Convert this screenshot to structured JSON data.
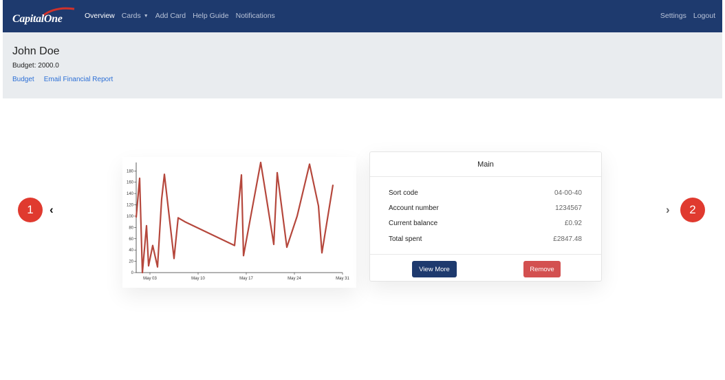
{
  "nav": {
    "logo_text": "CapitalOne",
    "items": [
      {
        "label": "Overview",
        "active": true
      },
      {
        "label": "Cards",
        "dropdown": true
      },
      {
        "label": "Add Card"
      },
      {
        "label": "Help Guide"
      },
      {
        "label": "Notifications"
      }
    ],
    "right_items": [
      {
        "label": "Settings"
      },
      {
        "label": "Logout"
      }
    ]
  },
  "header": {
    "name": "John Doe",
    "budget": "Budget: 2000.0",
    "links": [
      "Budget",
      "Email Financial Report"
    ]
  },
  "carousel": {
    "badge_left": "1",
    "badge_right": "2",
    "prev_icon": "chevron-left-icon",
    "next_icon": "chevron-right-icon"
  },
  "account": {
    "title": "Main",
    "details": [
      {
        "label": "Sort code",
        "value": "04-00-40"
      },
      {
        "label": "Account number",
        "value": "1234567"
      },
      {
        "label": "Current balance",
        "value": "£0.92"
      },
      {
        "label": "Total spent",
        "value": "£2847.48"
      }
    ],
    "view_more_label": "View More",
    "remove_label": "Remove"
  },
  "colors": {
    "navbar": "#1e3a6e",
    "header_bg": "#e9ecef",
    "link": "#2c6fd6",
    "badge": "#e03a2f",
    "line": "#b5473c",
    "view_button": "#1e3a6e",
    "remove_button": "#d35050"
  },
  "chart_data": {
    "type": "line",
    "x": [
      1.0,
      1.5,
      1.9,
      2.5,
      2.8,
      3.4,
      4.1,
      4.7,
      5.1,
      6.5,
      7.1,
      8.1,
      15.3,
      16.3,
      16.6,
      17.6,
      19.1,
      19.7,
      21.0,
      21.5,
      22.9,
      24.4,
      26.2,
      27.5,
      28.0,
      29.6
    ],
    "y": [
      98,
      167,
      0,
      83,
      12,
      48,
      10,
      130,
      174,
      25,
      97,
      90,
      48,
      173,
      30,
      96,
      195,
      150,
      50,
      177,
      45,
      100,
      192,
      118,
      35,
      155
    ],
    "x_range": [
      1,
      31
    ],
    "ylim": [
      0,
      195
    ],
    "y_ticks": [
      "0",
      "20",
      "40",
      "60",
      "80",
      "100",
      "120",
      "140",
      "160",
      "180"
    ],
    "x_ticks": [
      {
        "label": "May 03",
        "x": 3
      },
      {
        "label": "May 10",
        "x": 10
      },
      {
        "label": "May 17",
        "x": 17
      },
      {
        "label": "May 24",
        "x": 24
      },
      {
        "label": "May 31",
        "x": 31
      }
    ],
    "series": [
      {
        "values": []
      }
    ],
    "grid": false,
    "color": "#b5473c"
  }
}
